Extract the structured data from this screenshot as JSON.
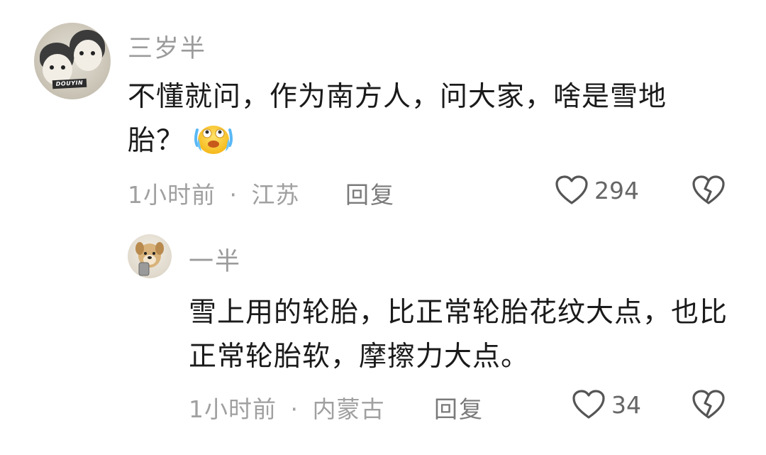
{
  "comment": {
    "username": "三岁半",
    "avatar_badge": "DOUYIN",
    "text": "不懂就问，作为南方人，问大家，啥是雪地胎？",
    "emoji": "cry-laugh-emoji",
    "time": "1小时前",
    "separator": "·",
    "location": "江苏",
    "reply_label": "回复",
    "like_count": "294"
  },
  "reply": {
    "username": "一半",
    "text": "雪上用的轮胎，比正常轮胎花纹大点，也比正常轮胎软，摩擦力大点。",
    "time": "1小时前",
    "separator": "·",
    "location": "内蒙古",
    "reply_label": "回复",
    "like_count": "34"
  },
  "icons": {
    "like": "heart-outline-icon",
    "dislike": "broken-heart-icon"
  },
  "colors": {
    "text_primary": "#1a1a1a",
    "text_secondary": "#9b9b9b",
    "icon_stroke": "#555555"
  }
}
